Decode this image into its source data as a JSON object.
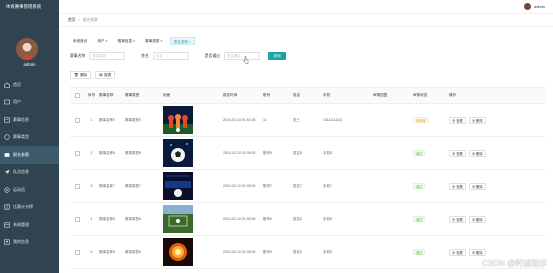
{
  "app": {
    "title": "体育赛事管理系统"
  },
  "topbar": {
    "username": "admin"
  },
  "sidebar": {
    "username": "admin",
    "items": [
      {
        "label": "首页",
        "icon": "home-icon",
        "active": false
      },
      {
        "label": "用户",
        "icon": "user-icon",
        "active": false
      },
      {
        "label": "赛事信息",
        "icon": "info-icon",
        "active": false
      },
      {
        "label": "赛事类型",
        "icon": "type-icon",
        "active": false
      },
      {
        "label": "报名参赛",
        "icon": "signup-icon",
        "active": true
      },
      {
        "label": "队员信息",
        "icon": "send-icon",
        "active": false
      },
      {
        "label": "运动员",
        "icon": "athlete-icon",
        "active": false
      },
      {
        "label": "比赛计分榜",
        "icon": "score-icon",
        "active": false
      },
      {
        "label": "系统管理",
        "icon": "system-icon",
        "active": false
      },
      {
        "label": "我的信息",
        "icon": "profile-icon",
        "active": false
      }
    ]
  },
  "breadcrumb": {
    "home": "首页",
    "current": "报名参赛"
  },
  "tags": [
    {
      "label": "系统首页",
      "active": false
    },
    {
      "label": "用户 ×",
      "active": false
    },
    {
      "label": "赛事信息 ×",
      "active": false
    },
    {
      "label": "赛事类型 ×",
      "active": false
    },
    {
      "label": "报名参赛 ×",
      "active": true
    }
  ],
  "search": {
    "field1_label": "赛事名称",
    "field1_placeholder": "赛事名称",
    "field2_label": "姓名",
    "field2_placeholder": "姓名",
    "field3_label": "是否通过",
    "field3_placeholder": "是否通过",
    "button": "查询"
  },
  "actions": {
    "delete": "删除",
    "report": "报表"
  },
  "table": {
    "headers": [
      "",
      "序号",
      "赛事名称",
      "赛事类型",
      "封面",
      "报名时间",
      "账号",
      "姓名",
      "手机",
      "审核回复",
      "审核状态",
      "操作"
    ],
    "rows": [
      {
        "idx": "1",
        "name": "赛事名称9",
        "type": "赛事类型9",
        "time": "2024-02-10 01:51:25",
        "account": "11",
        "person": "张三",
        "phone": "15111111111",
        "reply": "",
        "status": "待审核",
        "status_kind": "pending",
        "view": "查看",
        "del": "删除"
      },
      {
        "idx": "2",
        "name": "赛事名称8",
        "type": "赛事类型8",
        "time": "2024-02-10 01:39:30",
        "account": "账号8",
        "person": "姓名8",
        "phone": "手机8",
        "reply": "",
        "status": "通过",
        "status_kind": "pass",
        "view": "查看",
        "del": "删除"
      },
      {
        "idx": "3",
        "name": "赛事名称7",
        "type": "赛事类型7",
        "time": "2024-02-10 01:39:30",
        "account": "账号7",
        "person": "姓名7",
        "phone": "手机7",
        "reply": "",
        "status": "通过",
        "status_kind": "pass",
        "view": "查看",
        "del": "删除"
      },
      {
        "idx": "4",
        "name": "赛事名称6",
        "type": "赛事类型6",
        "time": "2024-02-10 01:39:30",
        "account": "账号6",
        "person": "姓名6",
        "phone": "手机6",
        "reply": "",
        "status": "通过",
        "status_kind": "pass",
        "view": "查看",
        "del": "删除"
      },
      {
        "idx": "5",
        "name": "赛事名称5",
        "type": "赛事类型5",
        "time": "2024-02-10 01:39:30",
        "account": "账号5",
        "person": "姓名5",
        "phone": "手机5",
        "reply": "",
        "status": "通过",
        "status_kind": "pass",
        "view": "查看",
        "del": "删除"
      }
    ]
  },
  "watermark": "CSDN @阿诚程序",
  "colors": {
    "sidebar": "#2f4350",
    "accent": "#1fa2a5",
    "active_menu": "#3d5a6c"
  }
}
